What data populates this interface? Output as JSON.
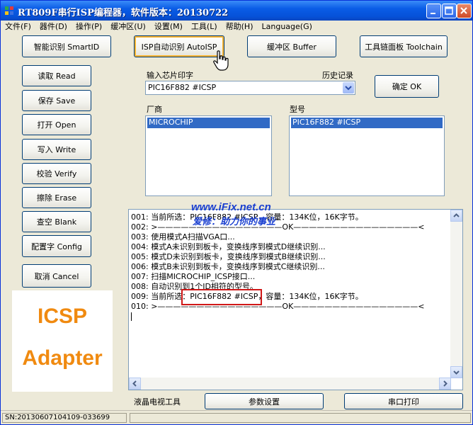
{
  "window": {
    "title": "RT809F串行ISP编程器，软件版本：20130722"
  },
  "menu": [
    "文件(F)",
    "器件(D)",
    "操作(P)",
    "缓冲区(U)",
    "设置(M)",
    "工具(L)",
    "帮助(H)",
    "Language(G)"
  ],
  "toolbar": {
    "smart_id": "智能识别 SmartID",
    "auto_isp": "ISP自动识别 AutoISP",
    "buffer": "缓冲区 Buffer",
    "toolchain": "工具链面板 Toolchain"
  },
  "actions": {
    "read": "读取 Read",
    "save": "保存 Save",
    "open": "打开 Open",
    "write": "写入 Write",
    "verify": "校验 Verify",
    "erase": "擦除 Erase",
    "blank": "查空 Blank",
    "config": "配置字 Config",
    "cancel": "取消 Cancel"
  },
  "chip": {
    "input_label": "输入芯片印字",
    "history_label": "历史记录",
    "value": "PIC16F882 #ICSP",
    "ok_button": "确定 OK",
    "vendor_label": "厂商",
    "model_label": "型号",
    "vendor_selected": "MICROCHIP",
    "model_selected": "PIC16F882 #ICSP"
  },
  "log": [
    "001: 当前所选：PIC16F882 #ICSP，容量：134K位，16K字节。",
    "002: >————————————————OK————————————————<",
    "003: 使用模式A扫描VGA口...",
    "004: 模式A未识别到板卡，变换线序到模式D继续识别...",
    "005: 模式D未识别到板卡，变换线序到模式B继续识别...",
    "006: 模式B未识别到板卡，变换线序到模式C继续识别...",
    "007: 扫描MICROCHIP_ICSP接口...",
    "008: 自动识别到1个ID相符的型号。",
    "009: 当前所选：PIC16F882 #ICSP，容量：134K位，16K字节。",
    "010: >————————————————OK————————————————<"
  ],
  "adapter": {
    "line1": "ICSP",
    "line2": "Adapter"
  },
  "watermark": {
    "url": "www.iFix.net.cn",
    "slogan": "爱修：助力你的事业"
  },
  "bottom": {
    "lcd_tool": "液晶电视工具",
    "params": "参数设置",
    "serial_print": "串口打印"
  },
  "status": {
    "sn": "SN:20130607104109-033699"
  },
  "colors": {
    "title_bar": "#0a5ce6",
    "selection": "#316ac5",
    "adapter_text": "#f08a10",
    "highlight_box": "#d01818",
    "watermark_url": "#1a3fd0",
    "watermark_slogan": "#1a3fd0"
  }
}
